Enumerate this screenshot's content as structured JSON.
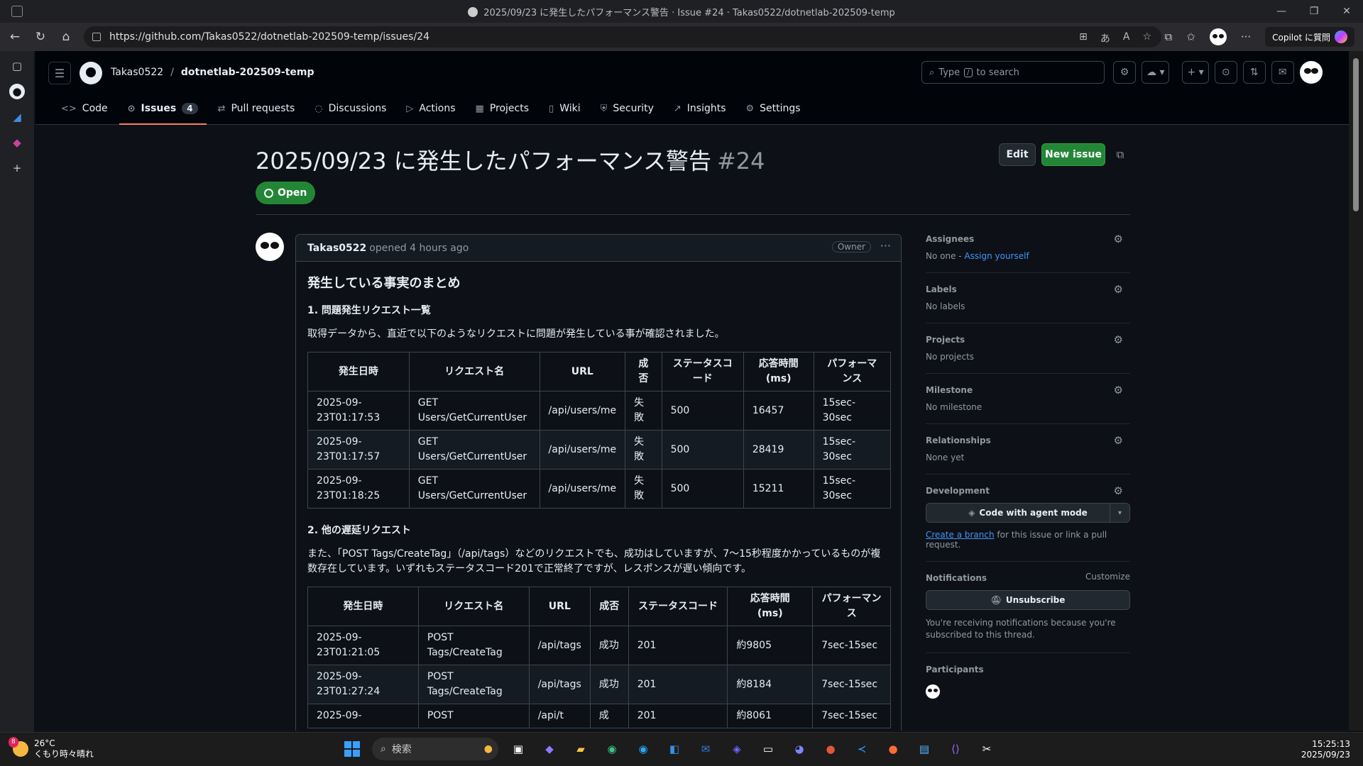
{
  "window": {
    "title": "2025/09/23 に発生したパフォーマンス警告 · Issue #24 · Takas0522/dotnetlab-202509-temp",
    "url": "https://github.com/Takas0522/dotnetlab-202509-temp/issues/24",
    "copilot_label": "Copilot に質問"
  },
  "header": {
    "owner": "Takas0522",
    "separator": "/",
    "repo": "dotnetlab-202509-temp",
    "search_placeholder_pre": "Type",
    "search_key": "/",
    "search_placeholder_post": "to search"
  },
  "tabs": [
    {
      "label": "Code",
      "icon": "code-icon"
    },
    {
      "label": "Issues",
      "icon": "issue-opened-icon",
      "count": "4",
      "active": true
    },
    {
      "label": "Pull requests",
      "icon": "git-pull-request-icon"
    },
    {
      "label": "Discussions",
      "icon": "comment-discussion-icon"
    },
    {
      "label": "Actions",
      "icon": "play-icon"
    },
    {
      "label": "Projects",
      "icon": "table-icon"
    },
    {
      "label": "Wiki",
      "icon": "book-icon"
    },
    {
      "label": "Security",
      "icon": "shield-icon"
    },
    {
      "label": "Insights",
      "icon": "graph-icon"
    },
    {
      "label": "Settings",
      "icon": "gear-icon"
    }
  ],
  "issue": {
    "title": "2025/09/23 に発生したパフォーマンス警告",
    "number": "#24",
    "state": "Open",
    "edit_label": "Edit",
    "new_issue_label": "New issue"
  },
  "comment": {
    "author": "Takas0522",
    "meta": "opened 4 hours ago",
    "role": "Owner",
    "heading": "発生している事実のまとめ",
    "section1": "1. 問題発生リクエスト一覧",
    "para1": "取得データから、直近で以下のようなリクエストに問題が発生している事が確認されました。",
    "section2": "2. 他の遅延リクエスト",
    "para2": "また、「POST Tags/CreateTag」（/api/tags）などのリクエストでも、成功はしていますが、7〜15秒程度かかっているものが複数存在しています。いずれもステータスコード201で正常終了ですが、レスポンスが遅い傾向です。",
    "table1": {
      "headers": [
        "発生日時",
        "リクエスト名",
        "URL",
        "成否",
        "ステータスコード",
        "応答時間 (ms)",
        "パフォーマンス"
      ],
      "rows": [
        [
          "2025-09-23T01:17:53",
          "GET Users/GetCurrentUser",
          "/api/users/me",
          "失敗",
          "500",
          "16457",
          "15sec-30sec"
        ],
        [
          "2025-09-23T01:17:57",
          "GET Users/GetCurrentUser",
          "/api/users/me",
          "失敗",
          "500",
          "28419",
          "15sec-30sec"
        ],
        [
          "2025-09-23T01:18:25",
          "GET Users/GetCurrentUser",
          "/api/users/me",
          "失敗",
          "500",
          "15211",
          "15sec-30sec"
        ]
      ]
    },
    "table2": {
      "headers": [
        "発生日時",
        "リクエスト名",
        "URL",
        "成否",
        "ステータスコード",
        "応答時間 (ms)",
        "パフォーマンス"
      ],
      "rows": [
        [
          "2025-09-23T01:21:05",
          "POST Tags/CreateTag",
          "/api/tags",
          "成功",
          "201",
          "約9805",
          "7sec-15sec"
        ],
        [
          "2025-09-23T01:27:24",
          "POST Tags/CreateTag",
          "/api/tags",
          "成功",
          "201",
          "約8184",
          "7sec-15sec"
        ],
        [
          "2025-09-",
          "POST",
          "/api/t",
          "成",
          "201",
          "約8061",
          "7sec-15sec"
        ]
      ]
    }
  },
  "sidebar": {
    "assignees": {
      "heading": "Assignees",
      "value": "No one - ",
      "link": "Assign yourself"
    },
    "labels": {
      "heading": "Labels",
      "value": "No labels"
    },
    "projects": {
      "heading": "Projects",
      "value": "No projects"
    },
    "milestone": {
      "heading": "Milestone",
      "value": "No milestone"
    },
    "relationships": {
      "heading": "Relationships",
      "value": "None yet"
    },
    "development": {
      "heading": "Development",
      "button": "Code with agent mode",
      "link": "Create a branch",
      "text": " for this issue or link a pull request."
    },
    "notifications": {
      "heading": "Notifications",
      "customize": "Customize",
      "button": "Unsubscribe",
      "text": "You're receiving notifications because you're subscribed to this thread."
    },
    "participants": {
      "heading": "Participants"
    }
  },
  "taskbar": {
    "temp": "26°C",
    "weather": "くもり時々晴れ",
    "badge": "8",
    "search": "検索",
    "time": "15:25:13",
    "date": "2025/09/23"
  }
}
